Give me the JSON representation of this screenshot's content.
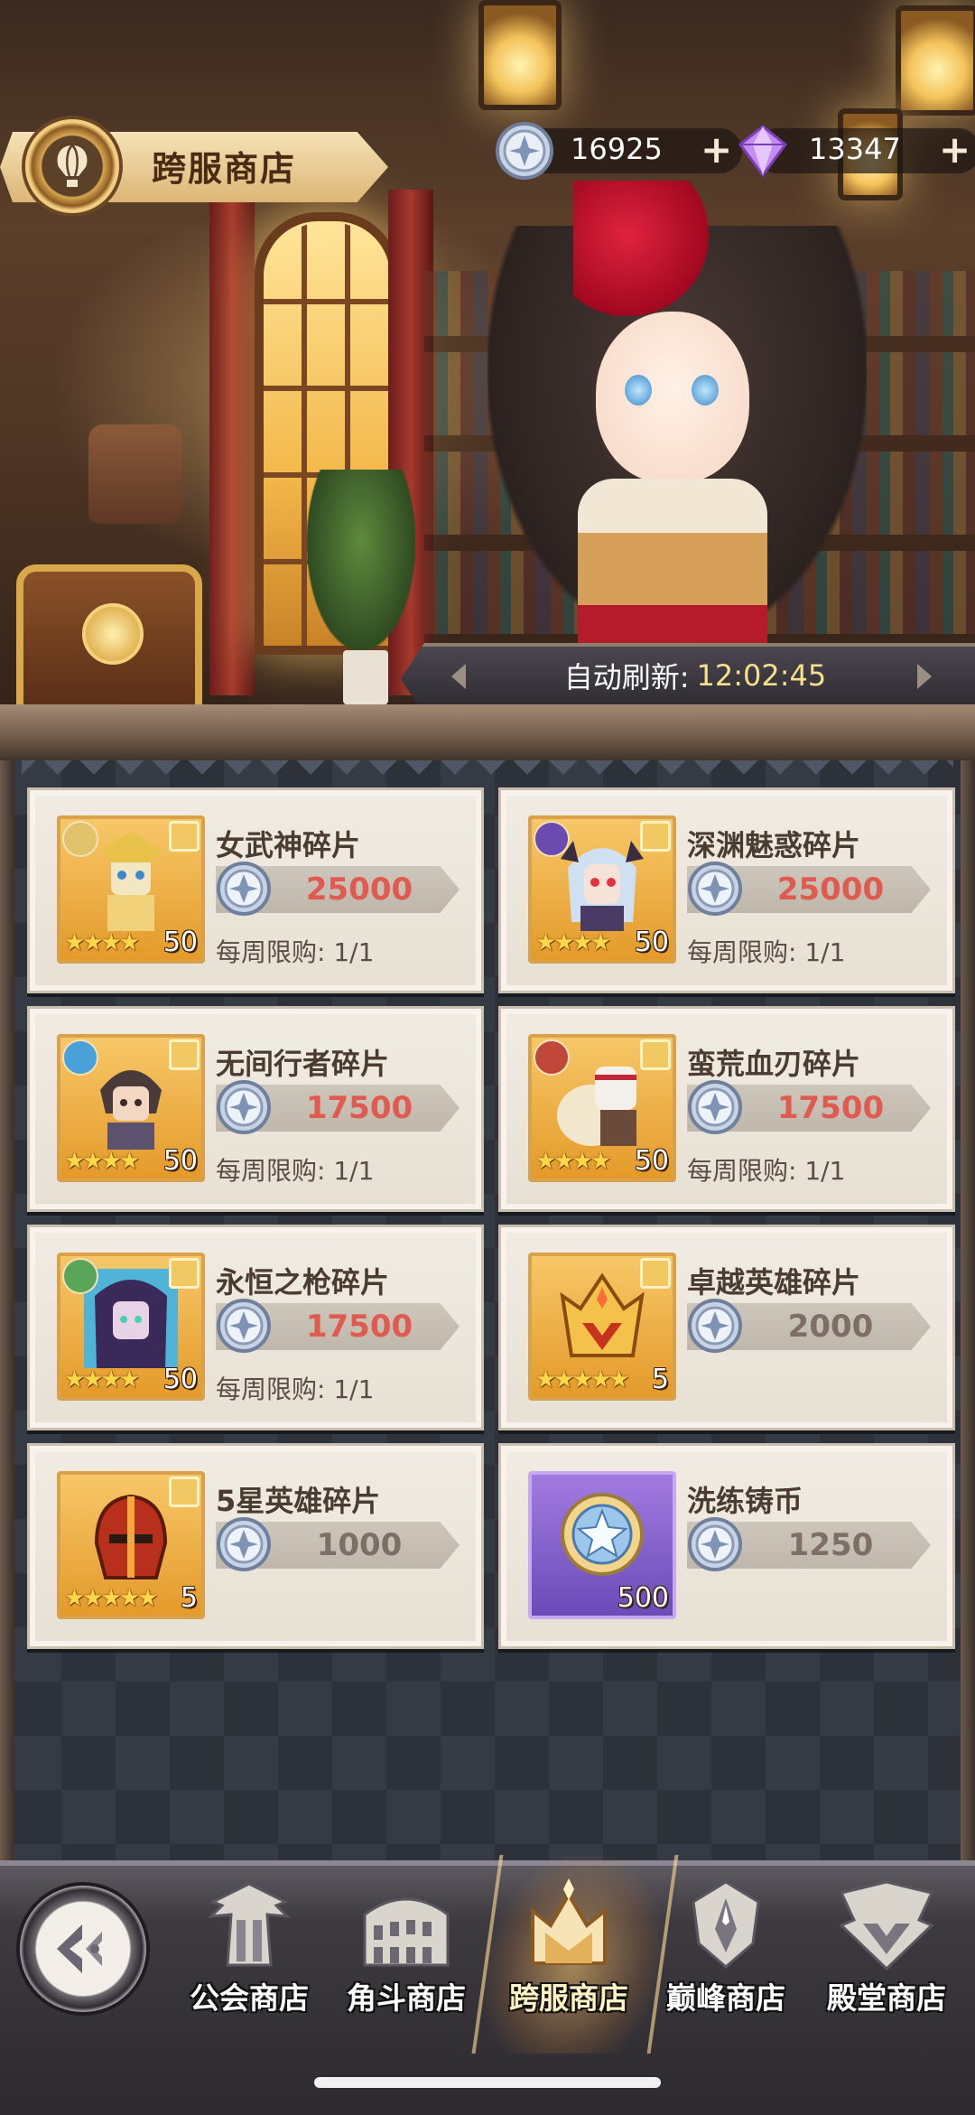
{
  "header": {
    "title": "跨服商店",
    "currencies": [
      {
        "icon": "silver-cross-coin-icon",
        "amount": "16925"
      },
      {
        "icon": "purple-diamond-icon",
        "amount": "13347"
      }
    ],
    "refresh": {
      "label": "自动刷新:",
      "time": "12:02:45"
    }
  },
  "items": [
    {
      "name": "女武神碎片",
      "price": "25000",
      "price_color": "#e05a4f",
      "limit": "每周限购: 1/1",
      "qty": "50",
      "stars": "★★★★",
      "art": "valkyrie-portrait-icon",
      "badge_color": "#e0c36a"
    },
    {
      "name": "深渊魅惑碎片",
      "price": "25000",
      "price_color": "#e05a4f",
      "limit": "每周限购: 1/1",
      "qty": "50",
      "stars": "★★★★",
      "art": "abyss-succubus-portrait-icon",
      "badge_color": "#6b4bb0"
    },
    {
      "name": "无间行者碎片",
      "price": "17500",
      "price_color": "#e05a4f",
      "limit": "每周限购: 1/1",
      "qty": "50",
      "stars": "★★★★",
      "art": "wanderer-portrait-icon",
      "badge_color": "#4aa0d8"
    },
    {
      "name": "蛮荒血刃碎片",
      "price": "17500",
      "price_color": "#e05a4f",
      "limit": "每周限购: 1/1",
      "qty": "50",
      "stars": "★★★★",
      "art": "savage-blade-portrait-icon",
      "badge_color": "#c0483a"
    },
    {
      "name": "永恒之枪碎片",
      "price": "17500",
      "price_color": "#e05a4f",
      "limit": "每周限购: 1/1",
      "qty": "50",
      "stars": "★★★★",
      "art": "eternal-spear-portrait-icon",
      "badge_color": "#5aa55a"
    },
    {
      "name": "卓越英雄碎片",
      "price": "2000",
      "price_color": "#7d6f63",
      "limit": "",
      "qty": "5",
      "stars": "★★★★★",
      "art": "golden-crown-helmet-icon",
      "badge_color": ""
    },
    {
      "name": "5星英雄碎片",
      "price": "1000",
      "price_color": "#7d6f63",
      "limit": "",
      "qty": "5",
      "stars": "★★★★★",
      "art": "red-helmet-icon",
      "badge_color": ""
    },
    {
      "name": "洗练铸币",
      "price": "1250",
      "price_color": "#7d6f63",
      "limit": "",
      "qty": "500",
      "stars": "",
      "art": "star-coin-icon",
      "badge_color": ""
    }
  ],
  "nav": {
    "back_icon": "back-arrow-icon",
    "tabs": [
      {
        "label": "公会商店",
        "icon": "guild-wings-icon"
      },
      {
        "label": "角斗商店",
        "icon": "colosseum-icon"
      },
      {
        "label": "跨服商店",
        "icon": "cross-server-crown-icon",
        "active": true
      },
      {
        "label": "巅峰商店",
        "icon": "peak-emblem-icon"
      },
      {
        "label": "殿堂商店",
        "icon": "hall-crest-icon"
      }
    ]
  }
}
